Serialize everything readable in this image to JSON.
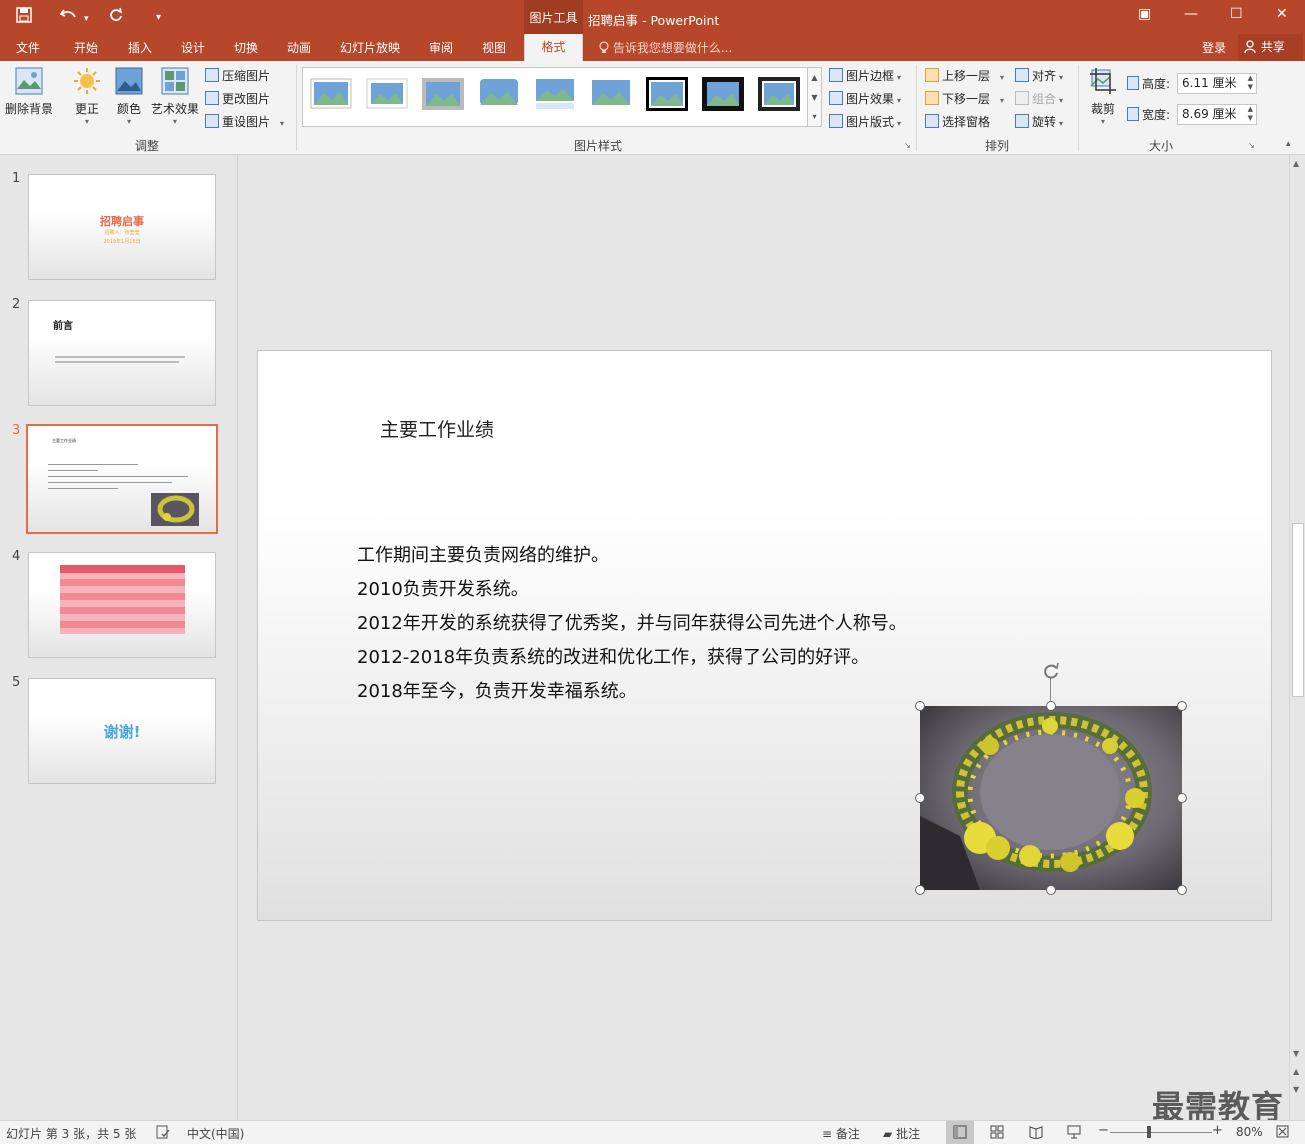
{
  "titlebar": {
    "context_tab": "图片工具",
    "doc_title": "招聘启事 - PowerPoint",
    "qa_caret": "▾",
    "win_restore": "▣",
    "win_min": "—",
    "win_max": "☐",
    "win_close": "✕"
  },
  "tabs": [
    "文件",
    "开始",
    "插入",
    "设计",
    "切换",
    "动画",
    "幻灯片放映",
    "审阅",
    "视图"
  ],
  "active_tab": "格式",
  "tellme": "告诉我您想要做什么...",
  "login": "登录",
  "share": "共享",
  "ribbon": {
    "adjust": {
      "remove_bg": "删除背景",
      "correct": "更正",
      "color": "颜色",
      "artistic": "艺术效果",
      "compress": "压缩图片",
      "change": "更改图片",
      "reset": "重设图片",
      "label": "调整"
    },
    "styles": {
      "border": "图片边框",
      "effects": "图片效果",
      "layout": "图片版式",
      "label": "图片样式"
    },
    "arrange": {
      "forward": "上移一层",
      "backward": "下移一层",
      "selection": "选择窗格",
      "align": "对齐",
      "group": "组合",
      "rotate": "旋转",
      "label": "排列"
    },
    "size": {
      "crop": "裁剪",
      "height_label": "高度:",
      "height_value": "6.11 厘米",
      "width_label": "宽度:",
      "width_value": "8.69 厘米",
      "label": "大小"
    }
  },
  "slides": [
    {
      "num": "1",
      "title": "招聘启事",
      "sub1": "招聘人：张莹莹",
      "sub2": "2019年1月15日"
    },
    {
      "num": "2",
      "title": "前言"
    },
    {
      "num": "3",
      "title": "主要工作业绩"
    },
    {
      "num": "4",
      "title": ""
    },
    {
      "num": "5",
      "title": "谢谢!"
    }
  ],
  "current_slide": {
    "title": "主要工作业绩",
    "lines": [
      "工作期间主要负责网络的维护。",
      "2010负责开发系统。",
      "2012年开发的系统获得了优秀奖，并与同年获得公司先进个人称号。",
      "2012-2018年负责系统的改进和优化工作，获得了公司的好评。",
      "2018年至今，负责开发幸福系统。"
    ]
  },
  "status": {
    "slide_info": "幻灯片 第 3 张，共 5 张",
    "language": "中文(中国)",
    "notes": "备注",
    "comments": "批注",
    "zoom": "80%",
    "zoom_minus": "−",
    "zoom_plus": "+"
  },
  "watermark": "最需教育",
  "colors": {
    "accent": "#b7472a",
    "selected_thumb": "#e46c4a"
  }
}
